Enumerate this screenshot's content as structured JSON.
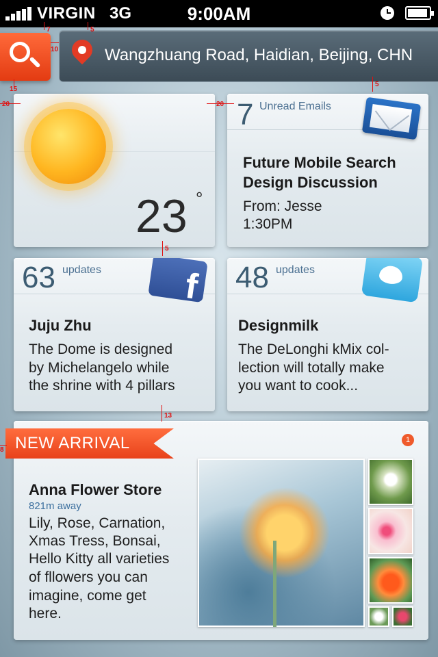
{
  "status_bar": {
    "carrier": "VIRGIN",
    "network": "3G",
    "time": "9:00AM"
  },
  "location": {
    "text": "Wangzhuang Road, Haidian, Beijing, CHN"
  },
  "weather": {
    "temperature": "23",
    "degree_symbol": "°",
    "icon": "sun-icon"
  },
  "email": {
    "count": "7",
    "label": "Unread Emails",
    "title_line1": "Future Mobile Search",
    "title_line2": "Design Discussion",
    "from": "From: Jesse",
    "time": "1:30PM"
  },
  "facebook": {
    "count": "63",
    "label": "updates",
    "name": "Juju Zhu",
    "body_lines": [
      "The Dome is designed",
      "by Michelangelo while",
      "the shrine with 4 pillars"
    ]
  },
  "twitter": {
    "count": "48",
    "label": "updates",
    "name": "Designmilk",
    "body_lines": [
      "The DeLonghi kMix col-",
      "lection will totally make",
      "you want to cook..."
    ]
  },
  "new_arrival": {
    "ribbon": "NEW ARRIVAL",
    "badge": "1",
    "store": "Anna Flower Store",
    "distance": "821m away",
    "body_lines": [
      "Lily, Rose, Carnation,",
      "Xmas Tress, Bonsai,",
      "Hello Kitty all varieties",
      "of fllowers you can",
      "imagine, come get",
      "here."
    ]
  },
  "annotations": [
    "7",
    "5",
    "10",
    "15",
    "20",
    "20",
    "5",
    "5",
    "13",
    "8"
  ],
  "colors": {
    "accent": "#e8421a",
    "text_blue": "#3c5c72",
    "status_bg": "#000000"
  }
}
